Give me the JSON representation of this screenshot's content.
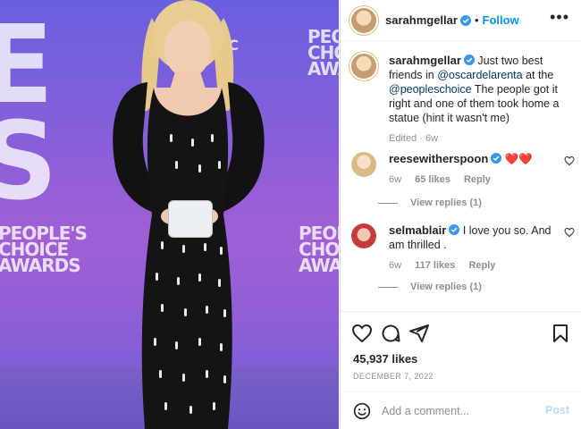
{
  "header": {
    "username": "sarahmgellar",
    "separator": "•",
    "follow_label": "Follow",
    "more_label": "•••"
  },
  "photo": {
    "bg_text_top": "PEOPLE'S\nCHOICE\nAWARDS",
    "bg_text_left": "PEOPLE'S\nCHOICE\nAWARDS",
    "bg_text_right": "PEOPLE'S\nCHOICE\nAWARDS",
    "network_text": "BC"
  },
  "caption": {
    "username": "sarahmgellar",
    "text_before": " Just two best friends in ",
    "mention1": "@oscardelarenta",
    "text_mid": " at the ",
    "mention2": "@peopleschoice",
    "text_after": " The people got it right and one of them took home a statue (hint it wasn't me)",
    "meta_edited": "Edited · 6w"
  },
  "comments": [
    {
      "username": "reesewitherspoon",
      "text": "❤️❤️",
      "age": "6w",
      "likes": "65 likes",
      "reply_label": "Reply",
      "view_replies": "View replies (1)"
    },
    {
      "username": "selmablair",
      "text": "I love you so. And am thrilled .",
      "age": "6w",
      "likes": "117 likes",
      "reply_label": "Reply",
      "view_replies": "View replies (1)"
    }
  ],
  "stats": {
    "likes": "45,937 likes",
    "date": "DECEMBER 7, 2022"
  },
  "comment_box": {
    "placeholder": "Add a comment...",
    "post_label": "Post"
  },
  "colors": {
    "accent": "#0095f6",
    "verified": "#3897f0",
    "post_disabled": "#b3dbff"
  }
}
